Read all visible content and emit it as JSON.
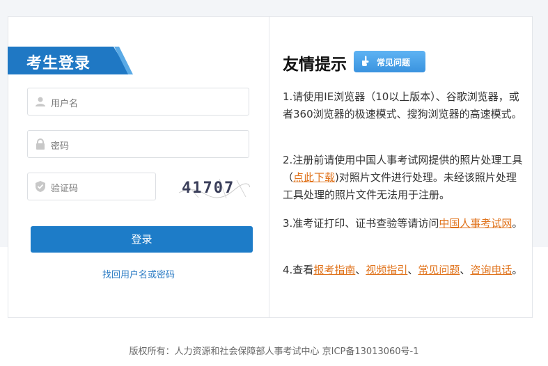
{
  "login": {
    "title": "考生登录",
    "username_placeholder": "用户名",
    "password_placeholder": "密码",
    "captcha_placeholder": "验证码",
    "captcha_text": "41707",
    "login_button": "登录",
    "forgot_link": "找回用户名或密码"
  },
  "tips": {
    "title": "友情提示",
    "faq_badge": "常见问题",
    "tip1": "1.请使用IE浏览器（10以上版本）、谷歌浏览器，或者360浏览器的极速模式、搜狗浏览器的高速模式。",
    "tip2_a": "2.注册前请使用中国人事考试网提供的照片处理工具（",
    "tip2_link": "点此下载",
    "tip2_b": ")对照片文件进行处理。未经该照片处理工具处理的照片文件无法用于注册。",
    "tip3_a": "3.准考证打印、证书查验等请访问",
    "tip3_link": "中国人事考试网",
    "tip3_b": "。",
    "tip4_a": "4.查看",
    "tip4_link1": "报考指南",
    "sep": "、",
    "tip4_link2": "视频指引",
    "tip4_link3": "常见问题",
    "tip4_link4": "咨询电话",
    "tip4_end": "。"
  },
  "footer": {
    "text": "版权所有：人力资源和社会保障部人事考试中心 京ICP备13013060号-1"
  },
  "colors": {
    "primary": "#1d7cc8",
    "link_orange": "#e0731c",
    "link_blue": "#2f7ec5"
  },
  "icons": [
    "user-icon",
    "lock-icon",
    "shield-check-icon",
    "pointing-hand-icon"
  ]
}
